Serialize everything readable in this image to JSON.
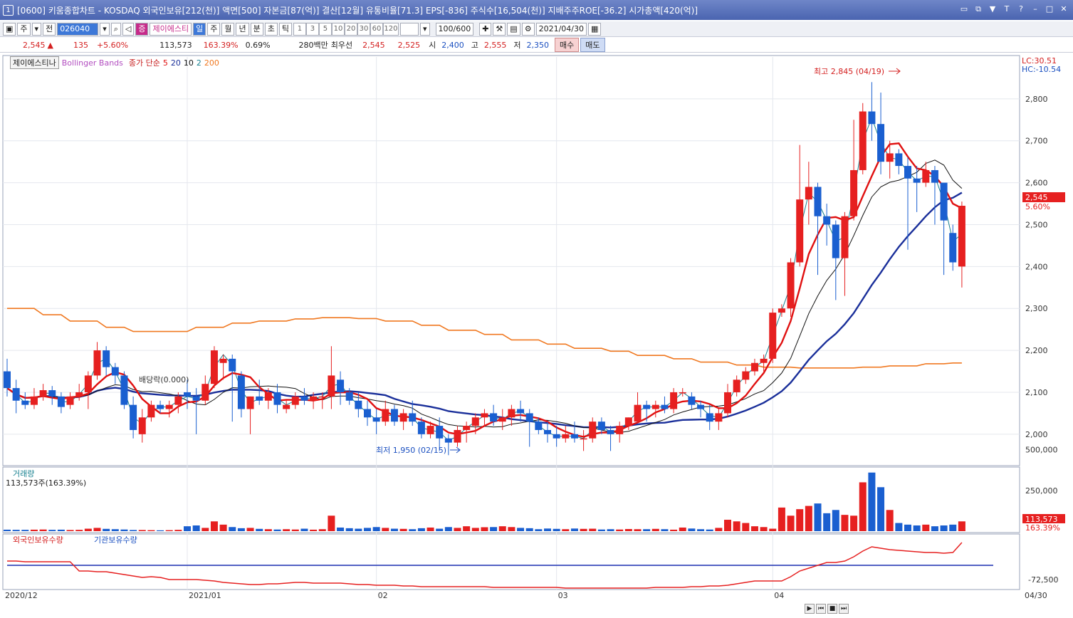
{
  "window": {
    "number": "1",
    "title": "[0600] 키움종합차트 - KOSDAQ 외국인보유[212(천)] 액면[500] 자본금[87(억)] 결산[12월] 유통비율[71.3] EPS[-836] 주식수[16,504(천)] 지배주주ROE[-36.2] 시가총액[420(억)]"
  },
  "toolbar": {
    "type": "주",
    "prev": "전",
    "code": "026040",
    "stock_badge": "증",
    "stock_name": "제이에스티",
    "periods": [
      "일",
      "주",
      "월",
      "년",
      "분",
      "초",
      "틱"
    ],
    "minutes": [
      "1",
      "3",
      "5",
      "10",
      "20",
      "30",
      "60",
      "120"
    ],
    "count": "100/600",
    "date": "2021/04/30"
  },
  "quote": {
    "price": "2,545",
    "change": "135",
    "change_rate": "+5.60%",
    "volume": "113,573",
    "volume_rate": "163.39%",
    "turnover": "0.69%",
    "amount": "280백만",
    "priority_label": "최우선",
    "ask": "2,545",
    "bid": "2,525",
    "open_label": "시",
    "open": "2,400",
    "high_label": "고",
    "high": "2,555",
    "low_label": "저",
    "low": "2,350",
    "buy": "매수",
    "sell": "매도"
  },
  "legend": {
    "stock": "제이에스티나",
    "bb": "Bollinger Bands",
    "ma": "종가 단순",
    "p5": "5",
    "p20": "20",
    "p10": "10",
    "p2": "2",
    "p200": "200"
  },
  "annotations": {
    "dividend": "배당락(0.000)",
    "max": "최고 2,845 (04/19)",
    "min": "최저 1,950 (02/15)",
    "lc": "LC:30.51",
    "hc": "HC:-10.54",
    "last_price": "2,545",
    "last_rate": "5.60%"
  },
  "volume_panel": {
    "title": "거래량",
    "value": "113,573주(163.39%)",
    "last": "113,573",
    "last_rate": "163.39%"
  },
  "holding_panel": {
    "foreign": "외국인보유수량",
    "inst": "기관보유수량"
  },
  "colors": {
    "up": "#e62020",
    "down": "#1a5fd0",
    "ma5": "#e01010",
    "ma10": "#111111",
    "ma20": "#1a2f9a",
    "ma200": "#f07820",
    "bb": "#17808f"
  },
  "chart_data": {
    "type": "candlestick",
    "y_ticks": [
      2000,
      2100,
      2200,
      2300,
      2400,
      2500,
      2600,
      2700,
      2800
    ],
    "ylim": [
      1925,
      2900
    ],
    "x_labels": [
      {
        "i": 0,
        "label": "2020/12"
      },
      {
        "i": 20,
        "label": "2021/01"
      },
      {
        "i": 41,
        "label": "02"
      },
      {
        "i": 61,
        "label": "03"
      },
      {
        "i": 85,
        "label": "04"
      },
      {
        "i": 109,
        "label": "04/30"
      }
    ],
    "ohlc": [
      [
        2150,
        2180,
        2090,
        2110
      ],
      [
        2110,
        2130,
        2050,
        2080
      ],
      [
        2080,
        2100,
        2060,
        2070
      ],
      [
        2070,
        2110,
        2060,
        2090
      ],
      [
        2090,
        2120,
        2080,
        2105
      ],
      [
        2105,
        2115,
        2070,
        2090
      ],
      [
        2090,
        2100,
        2050,
        2065
      ],
      [
        2070,
        2100,
        2060,
        2090
      ],
      [
        2090,
        2120,
        2080,
        2100
      ],
      [
        2100,
        2150,
        2060,
        2140
      ],
      [
        2140,
        2220,
        2130,
        2200
      ],
      [
        2200,
        2210,
        2140,
        2160
      ],
      [
        2160,
        2170,
        2120,
        2140
      ],
      [
        2140,
        2150,
        2060,
        2070
      ],
      [
        2070,
        2090,
        1990,
        2010
      ],
      [
        2000,
        2060,
        1980,
        2040
      ],
      [
        2040,
        2080,
        2030,
        2070
      ],
      [
        2070,
        2080,
        2050,
        2060
      ],
      [
        2060,
        2080,
        2040,
        2070
      ],
      [
        2070,
        2100,
        2050,
        2090
      ],
      [
        2100,
        2130,
        2060,
        2090
      ],
      [
        2090,
        2110,
        2000,
        2080
      ],
      [
        2080,
        2140,
        2070,
        2120
      ],
      [
        2120,
        2210,
        2110,
        2200
      ],
      [
        2170,
        2190,
        2130,
        2180
      ],
      [
        2180,
        2190,
        2030,
        2150
      ],
      [
        2140,
        2150,
        2040,
        2060
      ],
      [
        2060,
        2090,
        2000,
        2090
      ],
      [
        2090,
        2130,
        2070,
        2080
      ],
      [
        2080,
        2110,
        2060,
        2100
      ],
      [
        2100,
        2120,
        2050,
        2070
      ],
      [
        2060,
        2080,
        2050,
        2070
      ],
      [
        2070,
        2100,
        2060,
        2090
      ],
      [
        2090,
        2110,
        2070,
        2080
      ],
      [
        2080,
        2100,
        2060,
        2090
      ],
      [
        2090,
        2100,
        2060,
        2090
      ],
      [
        2090,
        2210,
        2060,
        2140
      ],
      [
        2130,
        2150,
        2070,
        2100
      ],
      [
        2100,
        2110,
        2070,
        2080
      ],
      [
        2080,
        2100,
        2040,
        2060
      ],
      [
        2060,
        2080,
        2020,
        2040
      ],
      [
        2040,
        2060,
        2000,
        2030
      ],
      [
        2030,
        2080,
        2020,
        2060
      ],
      [
        2060,
        2070,
        2020,
        2030
      ],
      [
        2030,
        2060,
        2010,
        2050
      ],
      [
        2050,
        2080,
        2020,
        2030
      ],
      [
        2030,
        2040,
        1990,
        2000
      ],
      [
        2000,
        2030,
        1990,
        2020
      ],
      [
        2020,
        2040,
        1960,
        1990
      ],
      [
        1990,
        2000,
        1950,
        1980
      ],
      [
        1980,
        2020,
        1970,
        2010
      ],
      [
        2010,
        2030,
        1980,
        2020
      ],
      [
        2020,
        2050,
        2000,
        2040
      ],
      [
        2040,
        2060,
        2020,
        2050
      ],
      [
        2050,
        2070,
        2020,
        2030
      ],
      [
        2030,
        2060,
        2010,
        2040
      ],
      [
        2040,
        2070,
        2020,
        2060
      ],
      [
        2060,
        2080,
        2030,
        2050
      ],
      [
        2050,
        2060,
        1970,
        2030
      ],
      [
        2030,
        2040,
        2000,
        2010
      ],
      [
        2010,
        2030,
        1980,
        2000
      ],
      [
        2000,
        2020,
        1970,
        1990
      ],
      [
        1990,
        2020,
        1980,
        2000
      ],
      [
        2000,
        2030,
        1980,
        1990
      ],
      [
        1990,
        2010,
        1960,
        1990
      ],
      [
        1990,
        2040,
        1980,
        2030
      ],
      [
        2030,
        2040,
        2000,
        2010
      ],
      [
        2010,
        2020,
        1960,
        2000
      ],
      [
        2000,
        2030,
        1980,
        2020
      ],
      [
        2020,
        2040,
        2010,
        2040
      ],
      [
        2030,
        2100,
        2030,
        2070
      ],
      [
        2070,
        2080,
        2030,
        2060
      ],
      [
        2060,
        2080,
        2040,
        2070
      ],
      [
        2070,
        2090,
        2050,
        2060
      ],
      [
        2060,
        2110,
        2050,
        2100
      ],
      [
        2100,
        2110,
        2090,
        2100
      ],
      [
        2090,
        2100,
        2060,
        2070
      ],
      [
        2070,
        2080,
        2040,
        2060
      ],
      [
        2050,
        2070,
        2010,
        2030
      ],
      [
        2030,
        2060,
        2010,
        2050
      ],
      [
        2050,
        2120,
        2040,
        2100
      ],
      [
        2100,
        2140,
        2090,
        2130
      ],
      [
        2130,
        2160,
        2120,
        2150
      ],
      [
        2150,
        2180,
        2140,
        2170
      ],
      [
        2170,
        2190,
        2150,
        2180
      ],
      [
        2180,
        2300,
        2170,
        2290
      ],
      [
        2290,
        2310,
        2280,
        2300
      ],
      [
        2300,
        2420,
        2280,
        2410
      ],
      [
        2410,
        2690,
        2400,
        2560
      ],
      [
        2560,
        2650,
        2500,
        2590
      ],
      [
        2590,
        2600,
        2380,
        2520
      ],
      [
        2520,
        2550,
        2450,
        2500
      ],
      [
        2500,
        2510,
        2320,
        2420
      ],
      [
        2420,
        2530,
        2330,
        2520
      ],
      [
        2520,
        2750,
        2510,
        2630
      ],
      [
        2630,
        2790,
        2620,
        2770
      ],
      [
        2770,
        2840,
        2700,
        2740
      ],
      [
        2740,
        2815,
        2620,
        2650
      ],
      [
        2650,
        2700,
        2610,
        2670
      ],
      [
        2670,
        2680,
        2620,
        2640
      ],
      [
        2640,
        2660,
        2440,
        2610
      ],
      [
        2610,
        2640,
        2530,
        2600
      ],
      [
        2600,
        2650,
        2590,
        2630
      ],
      [
        2630,
        2640,
        2500,
        2600
      ],
      [
        2600,
        2590,
        2380,
        2510
      ],
      [
        2480,
        2500,
        2390,
        2410
      ],
      [
        2400,
        2555,
        2350,
        2545
      ]
    ],
    "volume": [
      9000,
      8000,
      8000,
      9000,
      10000,
      8000,
      9000,
      7000,
      8000,
      15000,
      20000,
      14000,
      12000,
      10000,
      7000,
      7000,
      6000,
      5000,
      6000,
      8000,
      30000,
      35000,
      20000,
      60000,
      40000,
      25000,
      18000,
      20000,
      14000,
      12000,
      10000,
      12000,
      10000,
      15000,
      9000,
      12000,
      95000,
      22000,
      18000,
      15000,
      20000,
      25000,
      20000,
      15000,
      14000,
      12000,
      18000,
      22000,
      15000,
      25000,
      20000,
      30000,
      20000,
      24000,
      25000,
      30000,
      25000,
      20000,
      18000,
      12000,
      16000,
      14000,
      12000,
      16000,
      14000,
      15000,
      10000,
      12000,
      10000,
      13000,
      12000,
      12000,
      14000,
      12000,
      9000,
      22000,
      16000,
      12000,
      10000,
      20000,
      70000,
      60000,
      50000,
      30000,
      25000,
      15000,
      145000,
      95000,
      135000,
      155000,
      170000,
      110000,
      130000,
      100000,
      95000,
      300000,
      360000,
      270000,
      130000,
      50000,
      40000,
      35000,
      40000,
      30000,
      35000,
      40000,
      60000
    ],
    "volume_ticks": [
      250000,
      500000
    ],
    "foreign_holding_ticks": [
      "-72,500"
    ]
  }
}
